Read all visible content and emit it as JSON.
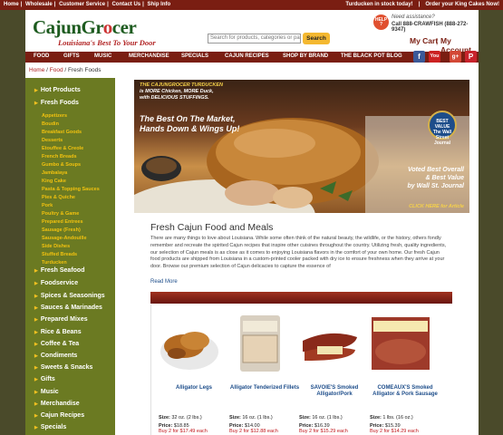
{
  "topbar": {
    "links": [
      "Home",
      "Wholesale",
      "Customer Service",
      "Contact Us",
      "Ship Info"
    ],
    "sep": "|",
    "promo1": "Turducken in stock today!",
    "promo2": "Order your King Cakes Now!"
  },
  "header": {
    "logo_a": "CajunGr",
    "logo_o": "o",
    "logo_b": "cer",
    "tagline": "Louisiana's Best To Your Door",
    "search_placeholder": "Search for products, categories or pa",
    "search_btn": "Search",
    "help_line1": "HELP",
    "help_line2": "?",
    "assist": "Need assistance?",
    "phone": "Call 888-CRAWFISH (888-272-9347)",
    "my_cart": "My Cart",
    "sep": "|",
    "my_account": "My Account"
  },
  "nav": [
    "FOOD",
    "GIFTS",
    "MUSIC",
    "MERCHANDISE",
    "SPECIALS",
    "CAJUN RECIPES",
    "SHOP BY BRAND",
    "THE BLACK POT BLOG"
  ],
  "social": [
    "f",
    "You",
    "g+",
    "P"
  ],
  "breadcrumb": {
    "home": "Home",
    "food": "Food",
    "current": "Fresh Foods",
    "sep": "/"
  },
  "sidebar": {
    "arrow": "▶",
    "top": [
      "Hot Products",
      "Fresh Foods"
    ],
    "sub": [
      "Appetizers",
      "Boudin",
      "Breakfast Goods",
      "Desserts",
      "Etouffee & Creole",
      "French Breads",
      "Gumbo & Soups",
      "Jambalaya",
      "King Cake",
      "Pasta & Topping Sauces",
      "Pies & Quiche",
      "Pork",
      "Poultry & Game",
      "Prepared Entrees",
      "Sausage (Fresh)",
      "Sausage-Andouille",
      "Side Dishes",
      "Stuffed Breads",
      "Turducken"
    ],
    "rest": [
      "Fresh Seafood",
      "Foodservice",
      "Spices & Seasonings",
      "Sauces & Marinades",
      "Prepared Mixes",
      "Rice & Beans",
      "Coffee & Tea",
      "Condiments",
      "Sweets & Snacks",
      "Gifts",
      "Music",
      "Merchandise",
      "Cajun Recipes",
      "Specials"
    ]
  },
  "hero": {
    "line1a": "THE CAJUNGROCER TURDUCKEN",
    "line1b": "is MORE Chicken, MORE Duck,",
    "line1c": "with DELICIOUS STUFFINGS.",
    "head1": "The Best On The Market,",
    "head2": "Hands Down & Wings Up!",
    "badge1": "BEST VALUE",
    "badge2": "The Wall Street Journal",
    "voted1": "Voted Best Overall",
    "voted2": "& Best Value",
    "voted3": "by Wall St. Journal",
    "clickhere": "CLICK HERE for Article"
  },
  "main": {
    "title": "Fresh Cajun Food and Meals",
    "text": "There are many things to love about Louisiana. While some often think of the natural beauty, the wildlife, or the history, others fondly remember and recreate the spirited Cajun recipes that inspire other cuisines throughout the country. Utilizing fresh, quality ingredients, our selection of Cajun meals is as close as it comes to enjoying Louisiana flavors in the comfort of your own home. Our fresh Cajun food products are shipped from Louisiana in a custom-printed cooler packed with dry ice to ensure freshness when they arrive at your door. Browse our premium selection of Cajun delicacies to capture the essence of",
    "read_more": "Read More"
  },
  "products": [
    {
      "name": "Alligator Legs",
      "size_label": "Size:",
      "size": "32 oz. (2 lbs.)",
      "price_label": "Price:",
      "price": "$18.85",
      "deal": "Buy 2 for $17.49 each"
    },
    {
      "name": "Alligator Tenderized Fillets",
      "size_label": "Size:",
      "size": "16 oz. (1 lbs.)",
      "price_label": "Price:",
      "price": "$14.00",
      "deal": "Buy 2 for $12.88 each"
    },
    {
      "name": "SAVOIE'S Smoked Alligator/Pork",
      "size_label": "Size:",
      "size": "16 oz. (1 lbs.)",
      "price_label": "Price:",
      "price": "$16.39",
      "deal": "Buy 2 for $15.29 each"
    },
    {
      "name": "COMEAUX'S Smoked Alligator & Pork Sausage",
      "size_label": "Size:",
      "size": "1 lbs. (16 oz.)",
      "price_label": "Price:",
      "price": "$15.39",
      "deal": "Buy 2 for $14.29 each"
    }
  ],
  "colors": {
    "maroon": "#7a1e12",
    "olive": "#6b7a22",
    "gold": "#f2c20f",
    "link_blue": "#1d4d8a"
  }
}
